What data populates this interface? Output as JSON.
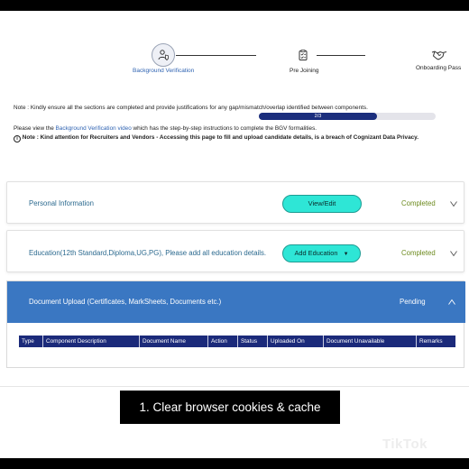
{
  "stepper": {
    "steps": [
      {
        "label": "Background Verification",
        "icon": "shield-person-icon",
        "active": true
      },
      {
        "label": "Pre Joining",
        "icon": "clipboard-check-icon",
        "active": false
      },
      {
        "label": "Onboarding Pass",
        "icon": "handshake-icon",
        "active": false
      }
    ]
  },
  "notes": {
    "line1": "Note : Kindly ensure all the sections are completed and provide justifications for any gap/mismatch/overlap identified between components.",
    "line2_prefix": "Please view the ",
    "line2_link": "Background Verification video",
    "line2_suffix": " which has the step-by-step instructions to complete the BGV formalities.",
    "line3": "Note : Kind attention for Recruiters and Vendors - Accessing this page to fill and upload candidate details, is a breach of Cognizant Data Privacy."
  },
  "progress": {
    "text": "2/3",
    "value": 0.6667
  },
  "sections": {
    "personal": {
      "title": "Personal Information",
      "button": "View/Edit",
      "status": "Completed"
    },
    "education": {
      "title": "Education(12th Standard,Diploma,UG,PG), Please add all education details.",
      "button": "Add Education",
      "status": "Completed"
    },
    "documents": {
      "title": "Document Upload (Certificates, MarkSheets, Documents etc.)",
      "status": "Pending",
      "columns": [
        "Type",
        "Component Description",
        "Document Name",
        "Action",
        "Status",
        "Uploaded On",
        "Document Unavailable",
        "Remarks"
      ]
    }
  },
  "caption": "1. Clear browser cookies & cache",
  "watermark": "TikTok",
  "colors": {
    "accent_teal": "#2ee6d6",
    "header_blue": "#3a77c2",
    "table_navy": "#1b2a7a",
    "completed_green": "#6c8a1e",
    "link_blue": "#2f63b2"
  }
}
